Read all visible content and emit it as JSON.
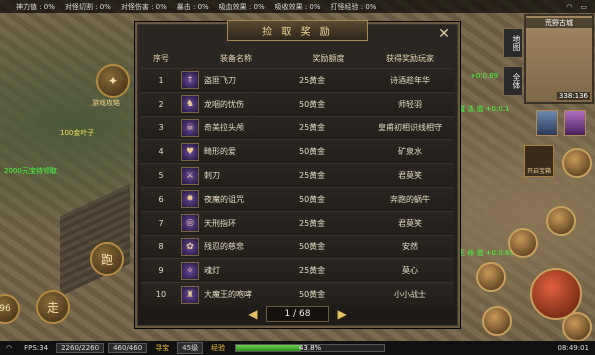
{
  "status_bar": {
    "items": [
      "神力值 : 0%",
      "对怪切割 : 0%",
      "对怪伤害 : 0%",
      "暴击 : 0%",
      "吸血效果 : 0%",
      "吸收效果 : 0%",
      "打怪经验 : 0%"
    ],
    "wifi": "wifi-icon",
    "battery": "battery-icon"
  },
  "panel": {
    "title": "捡 取 奖 励",
    "close": "✕",
    "columns": [
      "序号",
      "装备名称",
      "奖励额度",
      "获得奖励玩家"
    ],
    "rows": [
      {
        "rank": "1",
        "item": "盗匪飞刀",
        "amount": "25黄金",
        "player": "诗酒趁年华",
        "icon": "dagger-icon"
      },
      {
        "rank": "2",
        "item": "龙咽的忧伤",
        "amount": "50黄金",
        "player": "师轻羽",
        "icon": "dragon-icon"
      },
      {
        "rank": "3",
        "item": "奇美拉头颅",
        "amount": "25黄金",
        "player": "皇甫初相识线相守",
        "icon": "skull-icon"
      },
      {
        "rank": "4",
        "item": "畸形的爱",
        "amount": "50黄金",
        "player": "矿泉水",
        "icon": "heart-icon"
      },
      {
        "rank": "5",
        "item": "刺刀",
        "amount": "25黄金",
        "player": "君莫笑",
        "icon": "blade-icon"
      },
      {
        "rank": "6",
        "item": "夜魔的诅咒",
        "amount": "50黄金",
        "player": "奔跑的蜗牛",
        "icon": "curse-icon"
      },
      {
        "rank": "7",
        "item": "天刑指环",
        "amount": "25黄金",
        "player": "君莫笑",
        "icon": "ring-icon"
      },
      {
        "rank": "8",
        "item": "残忍的慈悲",
        "amount": "50黄金",
        "player": "安然",
        "icon": "mercy-icon"
      },
      {
        "rank": "9",
        "item": "魂灯",
        "amount": "25黄金",
        "player": "莫心",
        "icon": "lamp-icon"
      },
      {
        "rank": "10",
        "item": "大魔王的咆哮",
        "amount": "50黄金",
        "player": "小小战士",
        "icon": "demon-icon"
      }
    ],
    "pager": {
      "prev": "◀",
      "label": "1 / 68",
      "next": "▶"
    }
  },
  "minimap": {
    "title": "荒野古城",
    "coords": "338:136"
  },
  "side_tabs": [
    "地图",
    "全体"
  ],
  "left_hud": {
    "gift_label": "游戏攻略",
    "jump_label": "跑",
    "walk_label": "走",
    "gold_text": "100金叶子",
    "guild_text": "2000元宝待领取",
    "level_badge": "96"
  },
  "float_texts": [
    "+0:0.69",
    "魔 法 值 +0:0.1",
    "生 命 值 +0:0.69"
  ],
  "chest_label": "开启宝箱",
  "bottom_bar": {
    "fps": "FPS:34",
    "hp": "2260/2260",
    "mp": "460/460",
    "gold_label": "寻宝",
    "level": "45级",
    "exp_label": "经验",
    "exp_percent": 43.8,
    "exp_text": "43.8%",
    "time": "08:49:01"
  }
}
